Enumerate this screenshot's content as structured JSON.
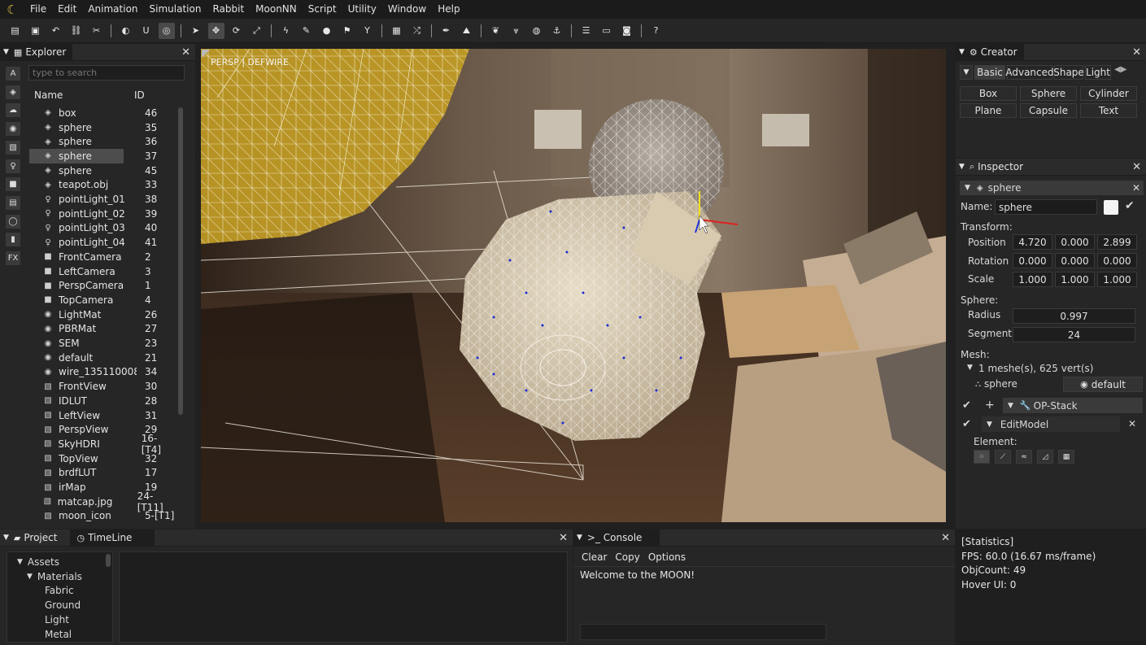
{
  "menu": [
    "File",
    "Edit",
    "Animation",
    "Simulation",
    "Rabbit",
    "MoonNN",
    "Script",
    "Utility",
    "Window",
    "Help"
  ],
  "toolbar": {
    "icons": [
      "new-file-icon",
      "save-icon",
      "undo-icon",
      "link-icon",
      "unlink-icon",
      "sep",
      "snap-off-icon",
      "magnet-icon",
      "snap-target-icon",
      "sep",
      "select-arrow-icon",
      "move-icon",
      "rotate-icon",
      "scale-icon",
      "sep",
      "flash-icon",
      "paint-icon",
      "drop-icon",
      "flag-icon",
      "funnel-icon",
      "sep",
      "grid-icon",
      "shuffle-icon",
      "sep",
      "brush-icon",
      "terrain-icon",
      "sep",
      "leaf-icon",
      "lungs-icon",
      "globe-icon",
      "anchor-icon",
      "sep",
      "list-icon",
      "window-icon",
      "camera-icon",
      "sep",
      "help-icon"
    ],
    "glyphs": [
      "▤",
      "▣",
      "↶",
      "⛓",
      "✂",
      "",
      "◐",
      "U",
      "◎",
      "",
      "➤",
      "✥",
      "⟳",
      "⤢",
      "",
      "ϟ",
      "✎",
      "●",
      "⚑",
      "Y",
      "",
      "▦",
      "⤮",
      "",
      "✒",
      "⛰",
      "",
      "❦",
      "⩔",
      "◍",
      "⚓",
      "",
      "☰",
      "▭",
      "◙",
      "",
      "?"
    ]
  },
  "explorer": {
    "title": "Explorer",
    "search_placeholder": "type to search",
    "col_name": "Name",
    "col_id": "ID",
    "side_tabs": [
      "A",
      "◈",
      "☁",
      "◉",
      "▧",
      "♀",
      "■",
      "▤",
      "◯",
      "▮",
      "FX"
    ],
    "rows": [
      {
        "icon": "◈",
        "name": "box",
        "id": "46"
      },
      {
        "icon": "◈",
        "name": "sphere",
        "id": "35"
      },
      {
        "icon": "◈",
        "name": "sphere",
        "id": "36"
      },
      {
        "icon": "◈",
        "name": "sphere",
        "id": "37",
        "selected": true
      },
      {
        "icon": "◈",
        "name": "sphere",
        "id": "45"
      },
      {
        "icon": "◈",
        "name": "teapot.obj",
        "id": "33"
      },
      {
        "icon": "♀",
        "name": "pointLight_01",
        "id": "38"
      },
      {
        "icon": "♀",
        "name": "pointLight_02",
        "id": "39"
      },
      {
        "icon": "♀",
        "name": "pointLight_03",
        "id": "40"
      },
      {
        "icon": "♀",
        "name": "pointLight_04",
        "id": "41"
      },
      {
        "icon": "■",
        "name": "FrontCamera",
        "id": "2"
      },
      {
        "icon": "■",
        "name": "LeftCamera",
        "id": "3"
      },
      {
        "icon": "■",
        "name": "PerspCamera",
        "id": "1"
      },
      {
        "icon": "■",
        "name": "TopCamera",
        "id": "4"
      },
      {
        "icon": "◉",
        "name": "LightMat",
        "id": "26"
      },
      {
        "icon": "◉",
        "name": "PBRMat",
        "id": "27"
      },
      {
        "icon": "◉",
        "name": "SEM",
        "id": "23"
      },
      {
        "icon": "◉",
        "name": "default",
        "id": "21"
      },
      {
        "icon": "◉",
        "name": "wire_135110008",
        "id": "34"
      },
      {
        "icon": "▧",
        "name": "FrontView",
        "id": "30"
      },
      {
        "icon": "▧",
        "name": "IDLUT",
        "id": "28"
      },
      {
        "icon": "▧",
        "name": "LeftView",
        "id": "31"
      },
      {
        "icon": "▧",
        "name": "PerspView",
        "id": "29"
      },
      {
        "icon": "▧",
        "name": "SkyHDRI",
        "id": "16-[T4]"
      },
      {
        "icon": "▧",
        "name": "TopView",
        "id": "32"
      },
      {
        "icon": "▧",
        "name": "brdfLUT",
        "id": "17"
      },
      {
        "icon": "▧",
        "name": "irMap",
        "id": "19"
      },
      {
        "icon": "▧",
        "name": "matcap.jpg",
        "id": "24-[T11]"
      },
      {
        "icon": "▧",
        "name": "moon_icon",
        "id": "5-[T1]"
      }
    ]
  },
  "viewport": {
    "label": "PERSP | DEFWIRE"
  },
  "creator": {
    "title": "Creator",
    "tabs": [
      "Basic",
      "Advanced",
      "Shape",
      "Light"
    ],
    "shapes": [
      "Box",
      "Sphere",
      "Cylinder",
      "Plane",
      "Capsule",
      "Text"
    ]
  },
  "inspector": {
    "title": "Inspector",
    "object": "sphere",
    "name_label": "Name:",
    "name_value": "sphere",
    "transform_label": "Transform:",
    "position_label": "Position",
    "position": [
      "4.720",
      "0.000",
      "2.899"
    ],
    "rotation_label": "Rotation",
    "rotation": [
      "0.000",
      "0.000",
      "0.000"
    ],
    "scale_label": "Scale",
    "scale": [
      "1.000",
      "1.000",
      "1.000"
    ],
    "sphere_label": "Sphere:",
    "radius_label": "Radius",
    "radius": "0.997",
    "segment_label": "Segment",
    "segment": "24",
    "mesh_label": "Mesh:",
    "mesh_summary": "1 meshe(s), 625 vert(s)",
    "mesh_name": "sphere",
    "mesh_material": "default",
    "opstack_label": "OP-Stack",
    "editmodel_label": "EditModel",
    "element_label": "Element:"
  },
  "project": {
    "tab_project": "Project",
    "tab_timeline": "TimeLine",
    "tree": [
      {
        "label": "Assets",
        "depth": 0,
        "arrow": "▼"
      },
      {
        "label": "Materials",
        "depth": 1,
        "arrow": "▼"
      },
      {
        "label": "Fabric",
        "depth": 2,
        "arrow": ""
      },
      {
        "label": "Ground",
        "depth": 2,
        "arrow": ""
      },
      {
        "label": "Light",
        "depth": 2,
        "arrow": ""
      },
      {
        "label": "Metal",
        "depth": 2,
        "arrow": ""
      }
    ]
  },
  "console": {
    "title": ">_ Console",
    "buttons": [
      "Clear",
      "Copy",
      "Options"
    ],
    "output": "Welcome to the MOON!"
  },
  "statistics": {
    "lines": [
      "[Statistics]",
      "FPS: 60.0 (16.67 ms/frame)",
      "ObjCount: 49",
      "Hover UI: 0"
    ]
  },
  "colors": {
    "accent": "#e8c44a",
    "selection": "#4d4d4d",
    "wire_teapot": "#c9a62e"
  }
}
